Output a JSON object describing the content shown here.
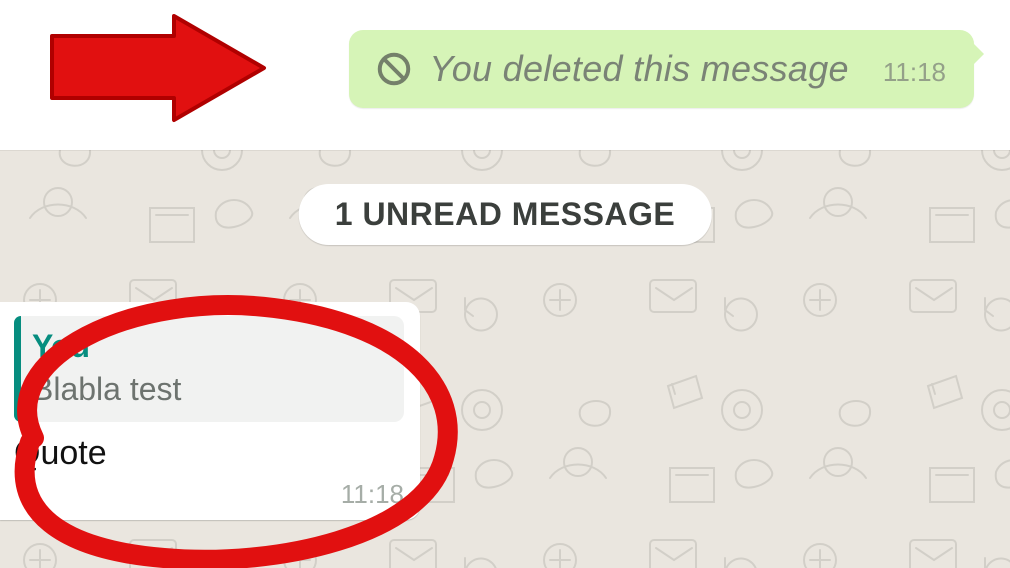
{
  "deleted_bubble": {
    "text": "You deleted this message",
    "time": "11:18"
  },
  "unread_banner": "1 UNREAD MESSAGE",
  "incoming": {
    "quote_sender": "You",
    "quote_body": "Blabla test",
    "message": "Quote",
    "time": "11:18"
  },
  "colors": {
    "outgoing_bg": "#d6f4b7",
    "quote_accent": "#068d7f",
    "annotation": "#e11010"
  }
}
